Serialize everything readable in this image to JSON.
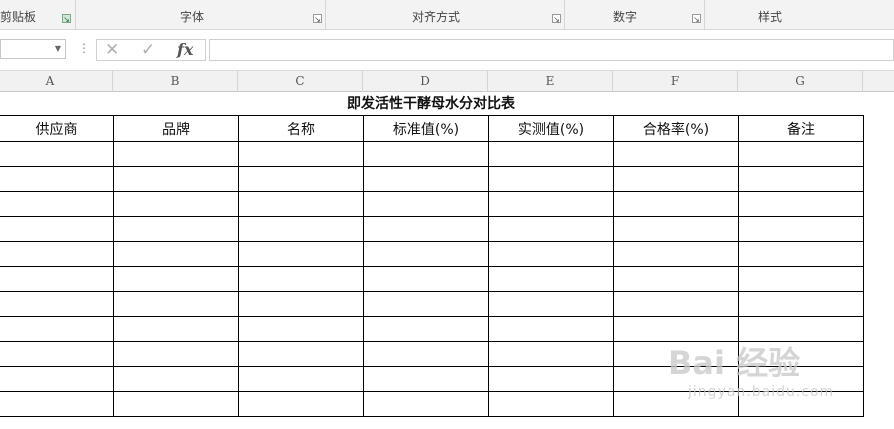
{
  "ribbon": {
    "groups": [
      {
        "label": "剪贴板"
      },
      {
        "label": "字体"
      },
      {
        "label": "对齐方式"
      },
      {
        "label": "数字"
      },
      {
        "label": "样式"
      }
    ]
  },
  "formula_bar": {
    "name_box": "",
    "cancel_icon": "✕",
    "enter_icon": "✓",
    "fx_label": "fx",
    "formula": ""
  },
  "columns": [
    "A",
    "B",
    "C",
    "D",
    "E",
    "F",
    "G"
  ],
  "sheet": {
    "title": "即发活性干酵母水分对比表",
    "headers": [
      "供应商",
      "品牌",
      "名称",
      "标准值(%)",
      "实测值(%)",
      "合格率(%)",
      "备注"
    ],
    "empty_rows": 11
  },
  "watermark": {
    "main": "Bai 经验",
    "sub": "jingyan.baidu.com"
  }
}
